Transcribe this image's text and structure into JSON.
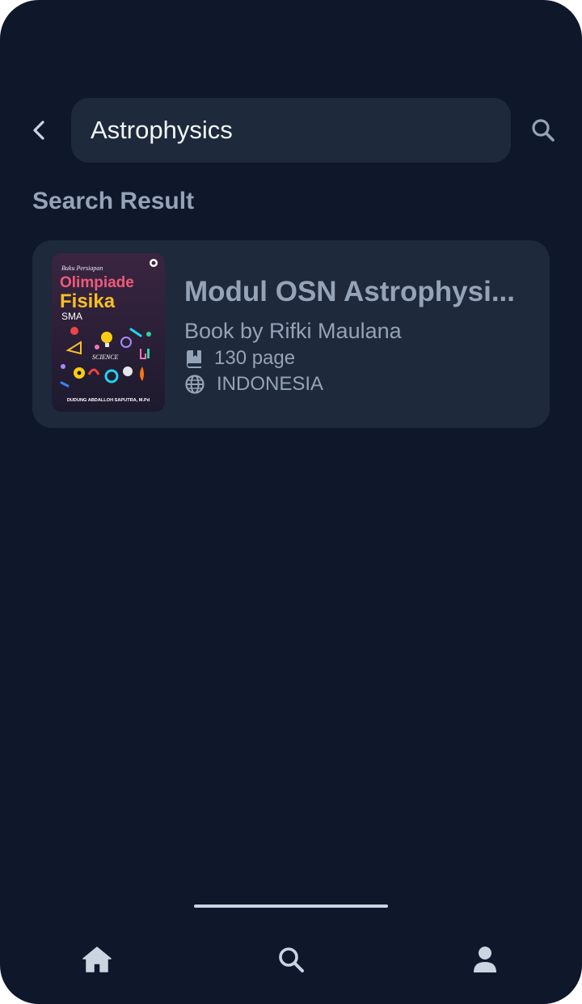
{
  "search": {
    "value": "Astrophysics",
    "back_icon": "chevron-left-icon",
    "search_icon": "search-icon"
  },
  "results": {
    "heading": "Search Result",
    "items": [
      {
        "title": "Modul OSN Astrophysi...",
        "author": "Book by Rifki Maulana",
        "pages": "130 page",
        "language": "INDONESIA",
        "cover": {
          "series": "Buku Persiapan",
          "title_line1": "Olimpiade",
          "title_line2": "Fisika",
          "level": "SMA",
          "badge": "SCIENCE",
          "author": "DUDUNG ABDALLOH SAPUTRA, M.Pd"
        }
      }
    ]
  },
  "bottom_nav": {
    "items": [
      {
        "name": "home",
        "icon": "home-icon"
      },
      {
        "name": "search",
        "icon": "search-icon"
      },
      {
        "name": "profile",
        "icon": "user-icon"
      }
    ]
  },
  "colors": {
    "background": "#0f172a",
    "surface": "#1e293b",
    "muted_text": "#94a3b8",
    "primary_text": "#f1f5f9",
    "icon": "#cbd5e1"
  }
}
